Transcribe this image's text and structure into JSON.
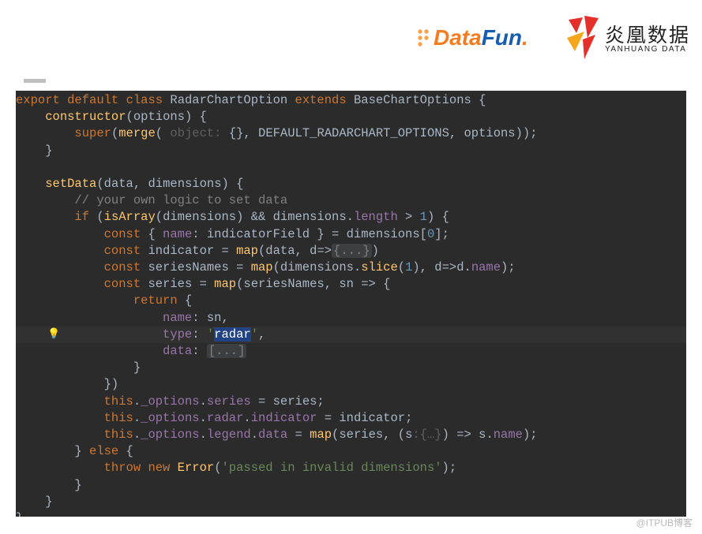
{
  "header": {
    "datafun_logo_text": "DataFun",
    "datafun_logo_dot": ".",
    "yanhuang_cn": "炎凰数据",
    "yanhuang_en": "YANHUANG DATA"
  },
  "code": {
    "tokens": [
      [
        "kw",
        "export"
      ],
      [
        "sp",
        " "
      ],
      [
        "kw",
        "default"
      ],
      [
        "sp",
        " "
      ],
      [
        "kw",
        "class"
      ],
      [
        "sp",
        " "
      ],
      [
        "cls",
        "RadarChartOption"
      ],
      [
        "sp",
        " "
      ],
      [
        "kw",
        "extends"
      ],
      [
        "sp",
        " "
      ],
      [
        "cls",
        "BaseChartOptions"
      ],
      [
        "sp",
        " "
      ],
      [
        "pun",
        "{"
      ],
      [
        "nl"
      ],
      [
        "sp",
        "    "
      ],
      [
        "fn",
        "constructor"
      ],
      [
        "pun",
        "("
      ],
      [
        "prm",
        "options"
      ],
      [
        "pun",
        ") {"
      ],
      [
        "nl"
      ],
      [
        "sp",
        "        "
      ],
      [
        "kw",
        "super"
      ],
      [
        "pun",
        "("
      ],
      [
        "fn",
        "merge"
      ],
      [
        "pun",
        "( "
      ],
      [
        "hint",
        "object:"
      ],
      [
        "sp",
        " "
      ],
      [
        "pun",
        "{}"
      ],
      [
        "pun",
        ", "
      ],
      [
        "prm",
        "DEFAULT_RADARCHART_OPTIONS"
      ],
      [
        "pun",
        ", "
      ],
      [
        "prm",
        "options"
      ],
      [
        "pun",
        "));"
      ],
      [
        "nl"
      ],
      [
        "sp",
        "    "
      ],
      [
        "pun",
        "}"
      ],
      [
        "nl"
      ],
      [
        "nl"
      ],
      [
        "sp",
        "    "
      ],
      [
        "fn",
        "setData"
      ],
      [
        "pun",
        "("
      ],
      [
        "prm",
        "data"
      ],
      [
        "pun",
        ", "
      ],
      [
        "prm",
        "dimensions"
      ],
      [
        "pun",
        ") {"
      ],
      [
        "nl"
      ],
      [
        "sp",
        "        "
      ],
      [
        "cmt",
        "// your own logic to set data"
      ],
      [
        "nl"
      ],
      [
        "sp",
        "        "
      ],
      [
        "kw",
        "if"
      ],
      [
        "pun",
        " ("
      ],
      [
        "fn",
        "isArray"
      ],
      [
        "pun",
        "("
      ],
      [
        "prm",
        "dimensions"
      ],
      [
        "pun",
        ") && "
      ],
      [
        "prm",
        "dimensions"
      ],
      [
        "pun",
        "."
      ],
      [
        "prop",
        "length"
      ],
      [
        "pun",
        " > "
      ],
      [
        "num",
        "1"
      ],
      [
        "pun",
        ") {"
      ],
      [
        "nl"
      ],
      [
        "sp",
        "            "
      ],
      [
        "kw",
        "const"
      ],
      [
        "pun",
        " { "
      ],
      [
        "prop",
        "name"
      ],
      [
        "pun",
        ": "
      ],
      [
        "prm",
        "indicatorField"
      ],
      [
        "pun",
        " } = "
      ],
      [
        "prm",
        "dimensions"
      ],
      [
        "pun",
        "["
      ],
      [
        "num",
        "0"
      ],
      [
        "pun",
        "];"
      ],
      [
        "nl"
      ],
      [
        "sp",
        "            "
      ],
      [
        "kw",
        "const"
      ],
      [
        "sp",
        " "
      ],
      [
        "prm",
        "indicator"
      ],
      [
        "pun",
        " = "
      ],
      [
        "fn",
        "map"
      ],
      [
        "pun",
        "("
      ],
      [
        "prm",
        "data"
      ],
      [
        "pun",
        ", "
      ],
      [
        "prm",
        "d"
      ],
      [
        "pun",
        "=>"
      ],
      [
        "fold",
        "{...}"
      ],
      [
        "pun",
        ")"
      ],
      [
        "nl"
      ],
      [
        "sp",
        "            "
      ],
      [
        "kw",
        "const"
      ],
      [
        "sp",
        " "
      ],
      [
        "prm",
        "seriesNames"
      ],
      [
        "pun",
        " = "
      ],
      [
        "fn",
        "map"
      ],
      [
        "pun",
        "("
      ],
      [
        "prm",
        "dimensions"
      ],
      [
        "pun",
        "."
      ],
      [
        "fn",
        "slice"
      ],
      [
        "pun",
        "("
      ],
      [
        "num",
        "1"
      ],
      [
        "pun",
        "), "
      ],
      [
        "prm",
        "d"
      ],
      [
        "pun",
        "=>"
      ],
      [
        "prm",
        "d"
      ],
      [
        "pun",
        "."
      ],
      [
        "prop",
        "name"
      ],
      [
        "pun",
        ");"
      ],
      [
        "nl"
      ],
      [
        "sp",
        "            "
      ],
      [
        "kw",
        "const"
      ],
      [
        "sp",
        " "
      ],
      [
        "prm",
        "series"
      ],
      [
        "pun",
        " = "
      ],
      [
        "fn",
        "map"
      ],
      [
        "pun",
        "("
      ],
      [
        "prm",
        "seriesNames"
      ],
      [
        "pun",
        ", "
      ],
      [
        "prm",
        "sn"
      ],
      [
        "pun",
        " => {"
      ],
      [
        "nl"
      ],
      [
        "sp",
        "                "
      ],
      [
        "kw",
        "return"
      ],
      [
        "pun",
        " {"
      ],
      [
        "nl"
      ],
      [
        "sp",
        "                    "
      ],
      [
        "prop",
        "name"
      ],
      [
        "pun",
        ": "
      ],
      [
        "prm",
        "sn"
      ],
      [
        "pun",
        ","
      ],
      [
        "nl"
      ],
      [
        "line-hl"
      ],
      [
        "sp",
        "                    "
      ],
      [
        "prop",
        "type"
      ],
      [
        "pun",
        ": "
      ],
      [
        "str",
        "'"
      ],
      [
        "sel",
        "radar"
      ],
      [
        "str",
        "'"
      ],
      [
        "pun",
        ","
      ],
      [
        "nl"
      ],
      [
        "sp",
        "                    "
      ],
      [
        "prop",
        "data"
      ],
      [
        "pun",
        ": "
      ],
      [
        "fold",
        "[...]"
      ],
      [
        "nl"
      ],
      [
        "sp",
        "                "
      ],
      [
        "pun",
        "}"
      ],
      [
        "nl"
      ],
      [
        "sp",
        "            "
      ],
      [
        "pun",
        "})"
      ],
      [
        "nl"
      ],
      [
        "sp",
        "            "
      ],
      [
        "this",
        "this"
      ],
      [
        "pun",
        "."
      ],
      [
        "prop",
        "_options"
      ],
      [
        "pun",
        "."
      ],
      [
        "prop",
        "series"
      ],
      [
        "pun",
        " = "
      ],
      [
        "prm",
        "series"
      ],
      [
        "pun",
        ";"
      ],
      [
        "nl"
      ],
      [
        "sp",
        "            "
      ],
      [
        "this",
        "this"
      ],
      [
        "pun",
        "."
      ],
      [
        "prop",
        "_options"
      ],
      [
        "pun",
        "."
      ],
      [
        "prop",
        "radar"
      ],
      [
        "pun",
        "."
      ],
      [
        "prop",
        "indicator"
      ],
      [
        "pun",
        " = "
      ],
      [
        "prm",
        "indicator"
      ],
      [
        "pun",
        ";"
      ],
      [
        "nl"
      ],
      [
        "sp",
        "            "
      ],
      [
        "this",
        "this"
      ],
      [
        "pun",
        "."
      ],
      [
        "prop",
        "_options"
      ],
      [
        "pun",
        "."
      ],
      [
        "prop",
        "legend"
      ],
      [
        "pun",
        "."
      ],
      [
        "prop",
        "data"
      ],
      [
        "pun",
        " = "
      ],
      [
        "fn",
        "map"
      ],
      [
        "pun",
        "("
      ],
      [
        "prm",
        "series"
      ],
      [
        "pun",
        ", ("
      ],
      [
        "prm",
        "s"
      ],
      [
        "hint",
        ":{…}"
      ],
      [
        "pun",
        ") => "
      ],
      [
        "prm",
        "s"
      ],
      [
        "pun",
        "."
      ],
      [
        "prop",
        "name"
      ],
      [
        "pun",
        ");"
      ],
      [
        "nl"
      ],
      [
        "sp",
        "        "
      ],
      [
        "pun",
        "} "
      ],
      [
        "kw",
        "else"
      ],
      [
        "pun",
        " {"
      ],
      [
        "nl"
      ],
      [
        "sp",
        "            "
      ],
      [
        "kw",
        "throw"
      ],
      [
        "sp",
        " "
      ],
      [
        "kw",
        "new"
      ],
      [
        "sp",
        " "
      ],
      [
        "fn",
        "Error"
      ],
      [
        "pun",
        "("
      ],
      [
        "str",
        "'passed in invalid dimensions'"
      ],
      [
        "pun",
        ");"
      ],
      [
        "nl"
      ],
      [
        "sp",
        "        "
      ],
      [
        "pun",
        "}"
      ],
      [
        "nl"
      ],
      [
        "sp",
        "    "
      ],
      [
        "pun",
        "}"
      ],
      [
        "nl"
      ],
      [
        "pun",
        "}"
      ]
    ]
  },
  "icons": {
    "bulb": "💡"
  },
  "watermark": "@ITPUB博客"
}
